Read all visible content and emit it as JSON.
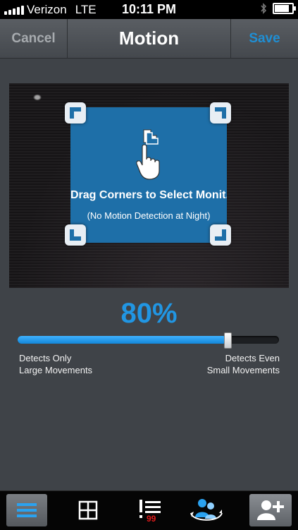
{
  "status_bar": {
    "carrier": "Verizon",
    "network": "LTE",
    "time": "10:11 PM"
  },
  "nav": {
    "cancel_label": "Cancel",
    "title": "Motion",
    "save_label": "Save"
  },
  "camera": {
    "instruction": "Drag Corners to Select Monit...",
    "note": "(No Motion Detection at Night)"
  },
  "sensitivity": {
    "value": 80,
    "display": "80%",
    "left_label_line1": "Detects Only",
    "left_label_line2": "Large Movements",
    "right_label_line1": "Detects Even",
    "right_label_line2": "Small Movements"
  },
  "toolbar": {
    "items": [
      {
        "icon": "menu-icon",
        "active": true
      },
      {
        "icon": "grid-icon",
        "active": false
      },
      {
        "icon": "alerts-icon",
        "active": false,
        "badge": "99"
      },
      {
        "icon": "people-rotate-icon",
        "active": false
      },
      {
        "icon": "add-user-icon",
        "active": true
      }
    ]
  },
  "colors": {
    "accent": "#2196e3",
    "save": "#1f8fd4",
    "motion_area": "#1e6fa8",
    "badge": "#e21b1b"
  }
}
